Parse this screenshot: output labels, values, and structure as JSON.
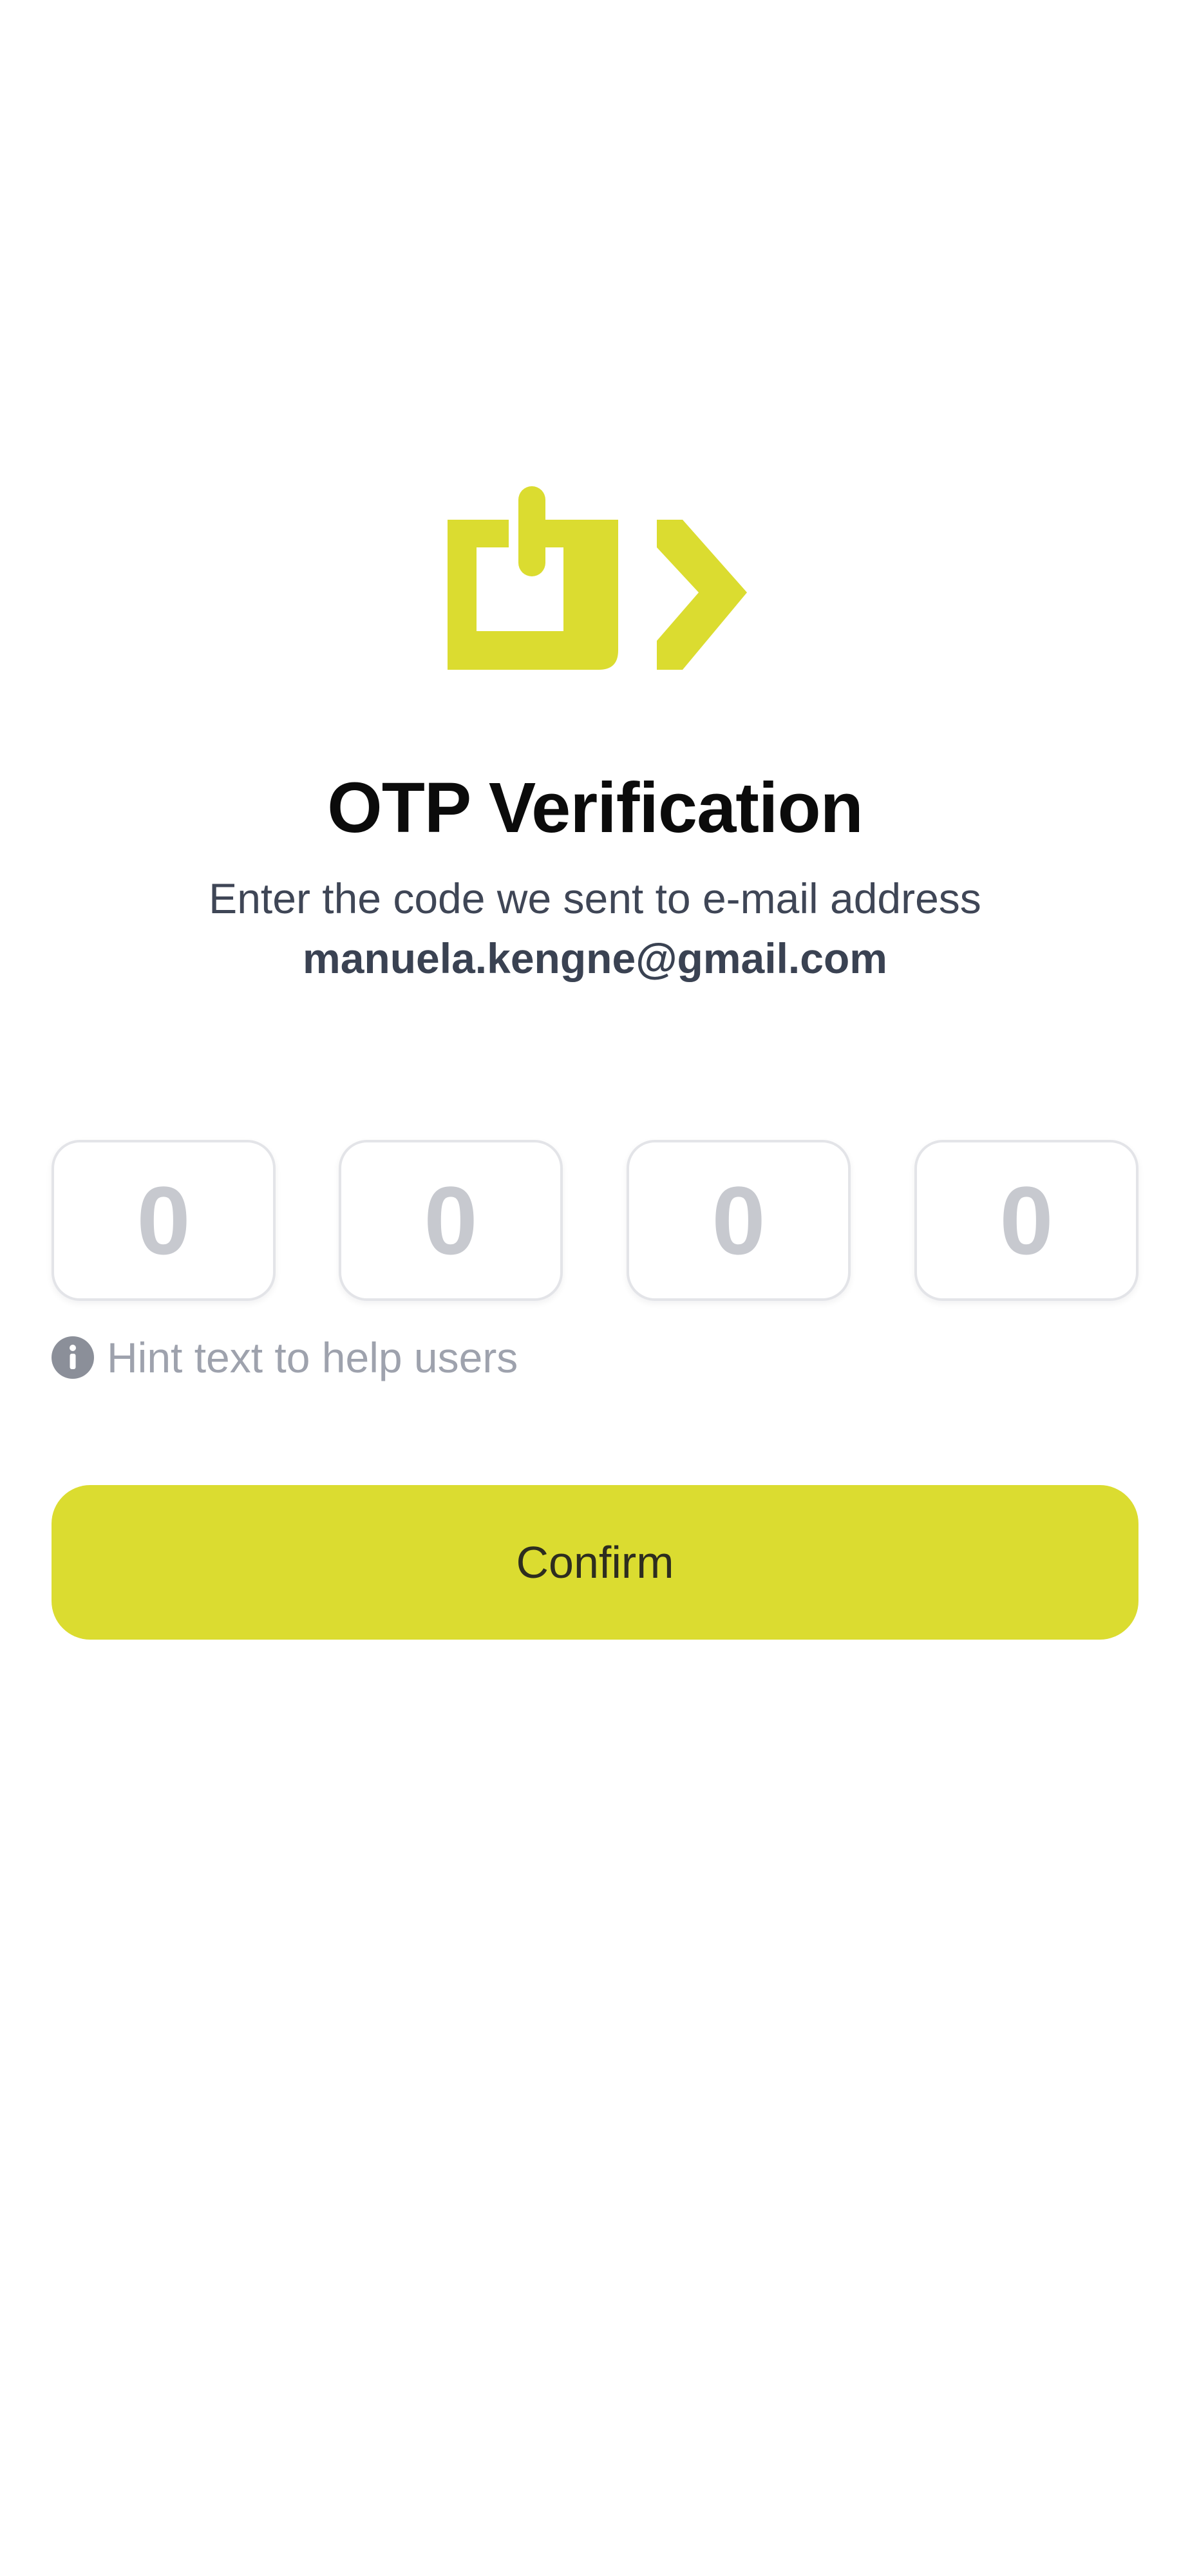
{
  "brand": {
    "logo_icon": "power-play-logo-icon",
    "accent_color": "#dbdc30"
  },
  "header": {
    "title": "OTP Verification",
    "subtitle": "Enter the code we sent to e-mail address",
    "email": "manuela.kengne@gmail.com"
  },
  "otp": {
    "digits": [
      {
        "placeholder": "0",
        "value": ""
      },
      {
        "placeholder": "0",
        "value": ""
      },
      {
        "placeholder": "0",
        "value": ""
      },
      {
        "placeholder": "0",
        "value": ""
      }
    ]
  },
  "hint": {
    "icon": "info-icon",
    "text": "Hint text to help users"
  },
  "actions": {
    "confirm_label": "Confirm"
  }
}
